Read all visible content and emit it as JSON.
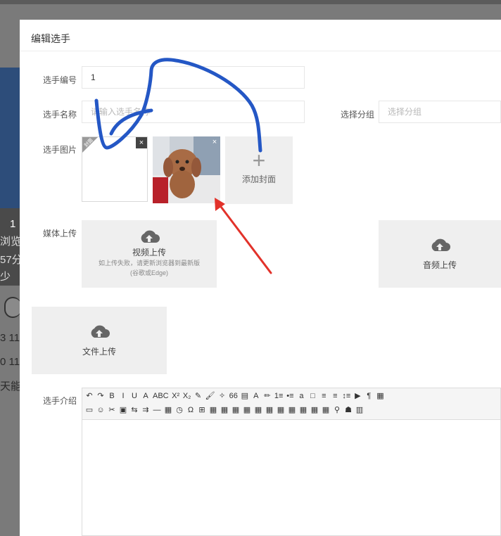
{
  "modal": {
    "title": "编辑选手"
  },
  "background": {
    "line1": "1",
    "line2": "浏览",
    "line3": "57分",
    "line4": "少",
    "line5": "3 11:",
    "line6": "0 11:",
    "line7": "天能"
  },
  "form": {
    "number_label": "选手编号",
    "number_value": "1",
    "name_label": "选手名称",
    "name_placeholder": "请输入选手名称",
    "group_label": "选择分组",
    "group_placeholder": "选择分组",
    "image_label": "选手图片",
    "add_cover_label": "添加封面",
    "corner_badge": "封面",
    "media_label": "媒体上传",
    "video_upload": {
      "title": "视频上传",
      "hint1": "如上传失败，请更新浏览器到最新版",
      "hint2": "(谷歌或Edge)"
    },
    "audio_upload": {
      "title": "音频上传"
    },
    "file_upload": {
      "title": "文件上传"
    },
    "intro_label": "选手介绍"
  },
  "toolbar": {
    "row1": [
      "↶",
      "↷",
      "B",
      "I",
      "U",
      "A",
      "ABC",
      "X²",
      "X₂",
      "✎",
      "🖌",
      "✧",
      "66",
      "▤",
      "A",
      "✏",
      "1≡",
      "•≡",
      "a",
      "□",
      "≡",
      "≡",
      "↕≡",
      "▶",
      "¶",
      "▦"
    ],
    "row2": [
      "▭",
      "☺",
      "✂",
      "▣",
      "⇆",
      "⇉",
      "—",
      "▦",
      "◷",
      "Ω",
      "⊞",
      "▦",
      "▦",
      "▦",
      "▦",
      "▦",
      "▦",
      "▦",
      "▦",
      "▦",
      "▦",
      "▦",
      "⚲",
      "☗",
      "▥"
    ]
  },
  "colors": {
    "annotation_blue": "#2457c5",
    "annotation_red": "#e2322a"
  }
}
